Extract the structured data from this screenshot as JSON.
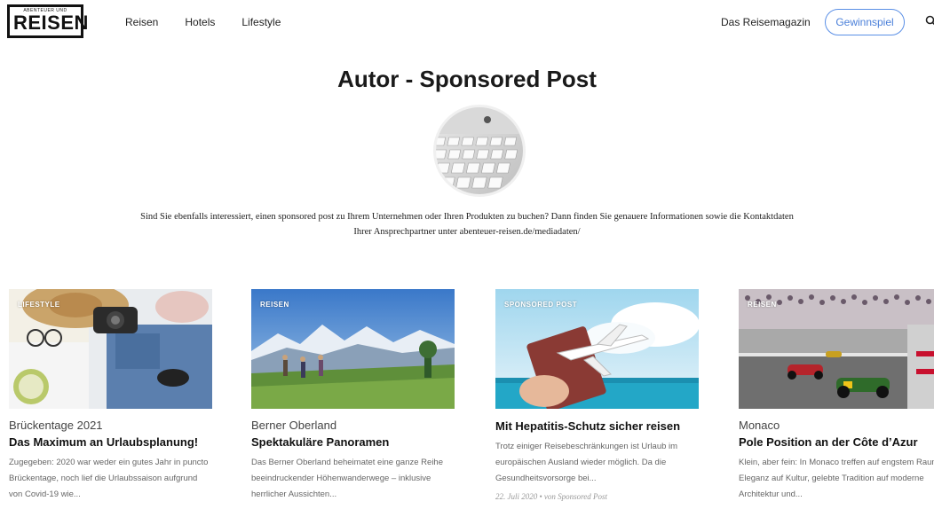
{
  "header": {
    "logo_small": "ABENTEUER UND",
    "logo_big": "REISEN",
    "nav": [
      "Reisen",
      "Hotels",
      "Lifestyle"
    ],
    "magazine_label": "Das Reisemagazin",
    "contest_button": "Gewinnspiel",
    "accent_color": "#4a7fd9"
  },
  "page": {
    "title": "Autor - Sponsored Post",
    "intro_line1": "Sind Sie ebenfalls interessiert, einen sponsored post zu Ihrem Unternehmen oder Ihren Produkten zu buchen? Dann finden Sie genauere Informationen sowie die Kontaktdaten",
    "intro_line2": "Ihrer Ansprechpartner unter abenteuer-reisen.de/mediadaten/"
  },
  "cards": [
    {
      "category": "LIFESTYLE",
      "kicker": "Brückentage 2021",
      "title": "Das Maximum an Urlaubsplanung!",
      "excerpt": "Zugegeben: 2020 war weder ein gutes Jahr in puncto Brückentage, noch lief die Urlaubssaison aufgrund von Covid-19 wie..."
    },
    {
      "category": "REISEN",
      "kicker": "Berner Oberland",
      "title": "Spektakuläre Panoramen",
      "excerpt": "Das Berner Oberland beheimatet eine ganze Reihe beeindruckender Höhenwanderwege – inklusive herrlicher Aussichten..."
    },
    {
      "category": "SPONSORED POST",
      "kicker": "",
      "title": "Mit Hepatitis-Schutz sicher reisen",
      "excerpt": "Trotz einiger Reisebeschränkungen ist Urlaub im europäischen Ausland wieder möglich. Da die Gesundheitsvorsorge bei...",
      "meta": "22. Juli 2020 • von Sponsored Post"
    },
    {
      "category": "REISEN",
      "kicker": "Monaco",
      "title": "Pole Position an der Côte d’Azur",
      "excerpt": "Klein, aber fein: In Monaco treffen auf engstem Raum Eleganz auf Kultur, gelebte Tradition auf moderne Architektur und..."
    }
  ],
  "icons": {
    "search": "search-icon",
    "avatar": "keyboard-photo"
  }
}
